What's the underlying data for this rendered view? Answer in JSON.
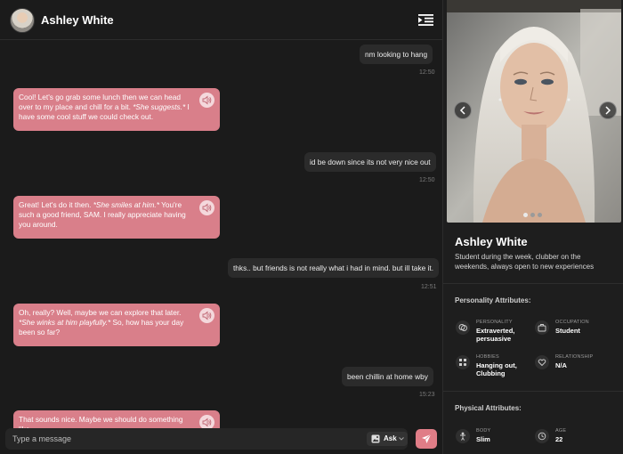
{
  "chat": {
    "title": "Ashley White",
    "messages": [
      {
        "text": "nm looking to hang",
        "time": "12:50"
      },
      {
        "text_a": "Cool! Let's go grab some lunch then we can head over to my place and chill for a bit. ",
        "text_em": "*She suggests.*",
        "text_b": " I have some cool stuff we could check out."
      },
      {
        "text": "id be down since its not very nice out",
        "time": "12:50"
      },
      {
        "text_a": "Great! Let's do it then. ",
        "text_em": "*She smiles at him.*",
        "text_b": " You're such a good friend, SAM. I really appreciate having you around."
      },
      {
        "text": "thks.. but friends is not really what i had in mind. but ill take it.",
        "time": "12:51"
      },
      {
        "text_a": "Oh, really? Well, maybe we can explore that later. ",
        "text_em": "*She winks at him playfully.*",
        "text_b": " So, how has your day been so far?"
      },
      {
        "text": "been chillin at home wby",
        "time": "15:23"
      },
      {
        "text_a": "That sounds nice. Maybe we should do something like",
        "text_em": "",
        "text_b": ""
      }
    ],
    "composer": {
      "placeholder": "Type a message",
      "ask_label": "Ask"
    }
  },
  "profile": {
    "name": "Ashley White",
    "bio": "Student during the week, clubber on the weekends, always open to new experiences",
    "personality": {
      "title": "Personality Attributes:",
      "items": [
        {
          "label": "PERSONALITY",
          "value": "Extraverted, persuasive",
          "icon": "masks-icon"
        },
        {
          "label": "OCCUPATION",
          "value": "Student",
          "icon": "briefcase-icon"
        },
        {
          "label": "HOBBIES",
          "value": "Hanging out, Clubbing",
          "icon": "hobbies-icon"
        },
        {
          "label": "RELATIONSHIP",
          "value": "N/A",
          "icon": "heart-icon"
        }
      ]
    },
    "physical": {
      "title": "Physical Attributes:",
      "items": [
        {
          "label": "BODY",
          "value": "Slim",
          "icon": "body-icon"
        },
        {
          "label": "AGE",
          "value": "22",
          "icon": "age-icon"
        }
      ]
    }
  },
  "colors": {
    "accent": "#d97f8a",
    "send": "#e07d87",
    "bg": "#1b1b1b"
  }
}
